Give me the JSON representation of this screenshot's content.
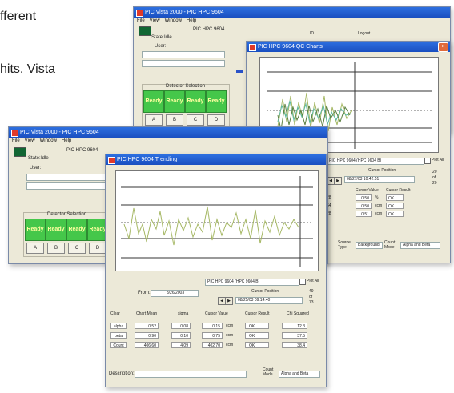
{
  "background": {
    "line1": "fferent",
    "line2": "hits. Vista"
  },
  "win_main": {
    "title": "PIC Vista 2000 - PIC HPC 9604",
    "menu": [
      "File",
      "View",
      "Window",
      "Help"
    ],
    "state_label": "State:",
    "state_value": "Idle",
    "device_label": "PIC HPC 9604",
    "user_label": "User:",
    "detector_label": "Detector Selection",
    "ready": [
      "Ready",
      "Ready",
      "Ready",
      "Ready"
    ],
    "detectors": [
      "A",
      "B",
      "C",
      "D"
    ],
    "tabs": [
      "ID",
      "Logout"
    ]
  },
  "win_qc": {
    "title": "PIC HPC 9604 QC Charts",
    "series_field": "PIC HPC 9604 (HPC 9604 B)",
    "plot_all": "Plot All",
    "cursor_position_label": "Cursor Position",
    "cursor_position_value": "08/27/03 10:42:51",
    "side_values": [
      "20",
      "of",
      "20"
    ],
    "cursor_value_label": "Cursor Value",
    "cursor_result_label": "Cursor Result",
    "rows": [
      {
        "label": "28",
        "value": "0.50",
        "unit": "%",
        "result": "OK"
      },
      {
        "label": "64",
        "value": "0.50",
        "unit": "ccm",
        "result": "OK"
      },
      {
        "label": "28",
        "value": "0.51",
        "unit": "ccm",
        "result": "OK"
      }
    ],
    "footer": [
      "Source Type",
      "Background",
      "Count Mode",
      "Alpha and Beta"
    ]
  },
  "win_trend": {
    "title": "PIC Vista 2000 - PIC HPC 9604",
    "menu": [
      "File",
      "View",
      "Window",
      "Help"
    ],
    "state_label": "State:",
    "state_value": "Idle",
    "device_label": "PIC HPC 9604",
    "user_label": "User:",
    "detector_label": "Detector Selection",
    "ready": [
      "Ready",
      "Ready",
      "Ready",
      "Ready"
    ],
    "detectors": [
      "A",
      "B",
      "C",
      "D"
    ]
  },
  "win_trending": {
    "title": "PIC HPC 9604 Trending",
    "series_field": "PIC HPC 9604 (HPC 9604 B)",
    "plot_all": "Plot All",
    "from_label": "From:",
    "from_value": "8/26/2003",
    "cursor_position_label": "Cursor Position",
    "cursor_position_value": "08/25/03 09:14:40",
    "side_values": [
      "49",
      "of",
      "73"
    ],
    "headers": [
      "Chart Mean",
      "sigma",
      "Cursor Value",
      "Cursor Result",
      "Chi Squared"
    ],
    "clear_label": "Clear",
    "rows": [
      {
        "label": "alpha",
        "mean": "0.52",
        "sigma": "0.08",
        "value": "0.15",
        "unit": "ccm",
        "result": "OK",
        "chi": "12.3"
      },
      {
        "label": "beta",
        "mean": "0.90",
        "sigma": "0.10",
        "value": "0.75",
        "unit": "ccm",
        "result": "OK",
        "chi": "37.5"
      },
      {
        "label": "Count",
        "mean": "406.60",
        "sigma": "4.09",
        "value": "402.70",
        "unit": "ccm",
        "result": "OK",
        "chi": "38.4"
      }
    ],
    "description_label": "Description:",
    "count_mode_label": "Count Mode",
    "count_mode_value": "Alpha and Beta"
  },
  "colors": {
    "titlebar": "#1a4fc0",
    "ready": "#45c74a",
    "trace_a": "#a6b865",
    "trace_b": "#5cb8a0",
    "trace_c": "#5a8040",
    "face": "#ece9d8"
  }
}
